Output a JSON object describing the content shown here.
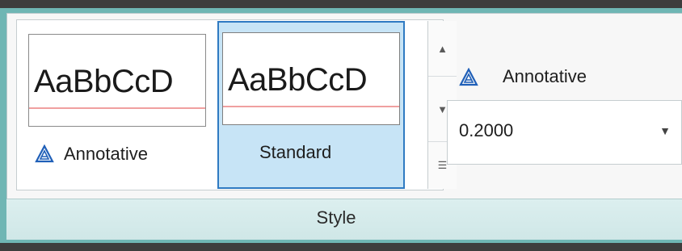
{
  "ribbon_panel": {
    "title": "Style"
  },
  "gallery": {
    "items": [
      {
        "preview_text": "AaBbCcD",
        "label": "Annotative",
        "icon": "annotative-icon",
        "selected": false
      },
      {
        "preview_text": "AaBbCcD",
        "label": "Standard",
        "icon": "",
        "selected": true
      }
    ],
    "scroll": {
      "up_glyph": "▲",
      "down_glyph": "▼",
      "more_glyph": "☰"
    }
  },
  "current_style": {
    "label": "Annotative",
    "icon": "annotative-icon"
  },
  "scale_combo": {
    "value": "0.2000",
    "arrow": "▼"
  },
  "colors": {
    "accent_frame": "#6fb6b4",
    "selected_fill": "#c7e4f6",
    "selected_border": "#2f7ac2",
    "icon_blue": "#1f5fb8"
  }
}
